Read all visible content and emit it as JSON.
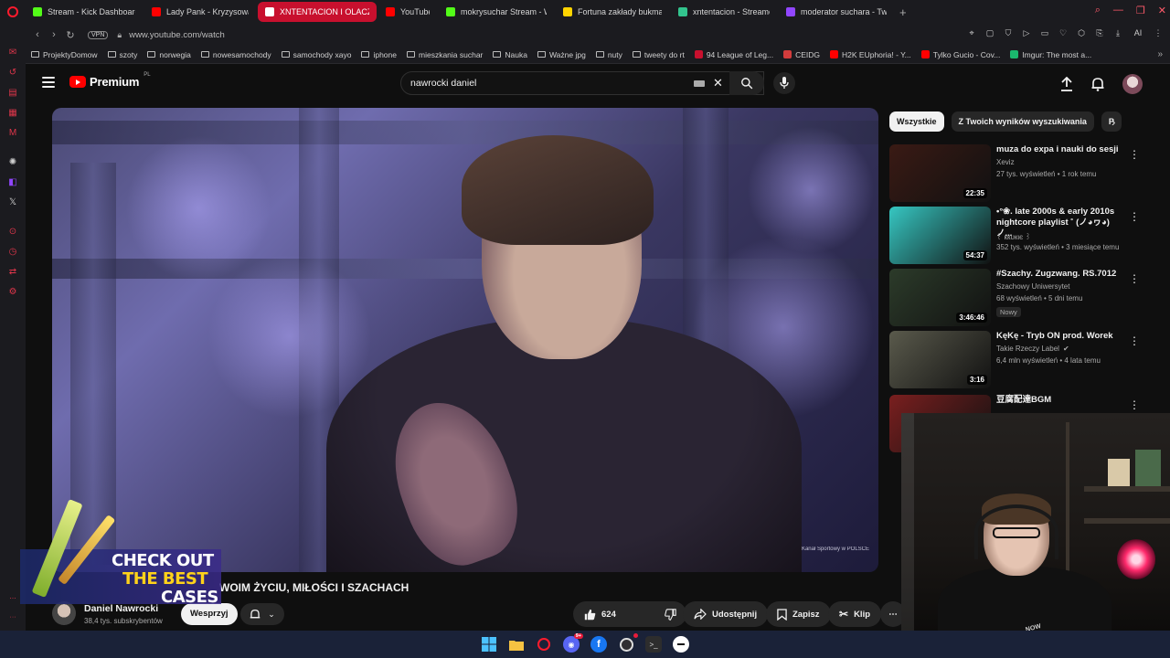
{
  "browser": {
    "tabs": [
      {
        "label": "Stream - Kick Dashboard",
        "icon": "kick-icon",
        "color": "#53fc18",
        "active": false
      },
      {
        "label": "Lady Pank - Kryzysowa N",
        "icon": "youtube-icon",
        "color": "#ff0000",
        "active": false
      },
      {
        "label": "XNTENTACION I OLACZK",
        "icon": "youtube-icon",
        "color": "#ff0000",
        "active": true
      },
      {
        "label": "YouTube",
        "icon": "youtube-icon",
        "color": "#ff0000",
        "active": false
      },
      {
        "label": "mokrysuchar Stream - We",
        "icon": "kick-icon",
        "color": "#53fc18",
        "active": false
      },
      {
        "label": "Fortuna zakłady bukmache",
        "icon": "fortuna-icon",
        "color": "#ffd400",
        "active": false
      },
      {
        "label": "xntentacion - Streamer Ov",
        "icon": "tt-icon",
        "color": "#32c48d",
        "active": false
      },
      {
        "label": "moderator suchara - Twitc",
        "icon": "twitch-icon",
        "color": "#9146ff",
        "active": false
      }
    ],
    "new_tab": "+",
    "url": "www.youtube.com/watch",
    "vpn": "VPN",
    "ai_label": "AI",
    "bookmarks": [
      {
        "label": "ProjektyDomow",
        "type": "folder"
      },
      {
        "label": "szoty",
        "type": "folder"
      },
      {
        "label": "norwegia",
        "type": "folder"
      },
      {
        "label": "nowesamochody",
        "type": "folder"
      },
      {
        "label": "samochody xayo",
        "type": "folder"
      },
      {
        "label": "iphone",
        "type": "folder"
      },
      {
        "label": "mieszkania suchar",
        "type": "folder"
      },
      {
        "label": "Nauka",
        "type": "folder"
      },
      {
        "label": "Ważne jpg",
        "type": "folder"
      },
      {
        "label": "nuty",
        "type": "folder"
      },
      {
        "label": "tweety do rt",
        "type": "folder"
      },
      {
        "label": "94 League of Leg...",
        "type": "site",
        "color": "#c8102e"
      },
      {
        "label": "CEIDG",
        "type": "site",
        "color": "#d23c3c"
      },
      {
        "label": "H2K EUphoria! - Y...",
        "type": "site",
        "color": "#ff0000"
      },
      {
        "label": "Tylko Gucio - Cov...",
        "type": "site",
        "color": "#ff0000"
      },
      {
        "label": "Imgur: The most a...",
        "type": "site",
        "color": "#1bb76e"
      }
    ]
  },
  "youtube": {
    "logo_text": "Premium",
    "logo_region": "PL",
    "search_value": "nawrocki daniel",
    "video": {
      "title": "WOIM ŻYCIU, MIŁOŚCI I SZACHACH",
      "watermark": "Kanał Sportowy w POLSCE",
      "channel_name": "Daniel Nawrocki",
      "subscribers": "38,4 tys. subskrybentów",
      "join_label": "Wesprzyj",
      "likes": "624",
      "share_label": "Udostępnij",
      "save_label": "Zapisz",
      "clip_label": "Klip"
    },
    "chips": [
      "Wszystkie",
      "Z Twoich wyników wyszukiwania",
      "P"
    ],
    "recommendations": [
      {
        "title": "muza do expa i nauki do sesji",
        "channel": "Xeviz",
        "meta": "27 tys. wyświetleń • 1 rok temu",
        "duration": "22:35",
        "thumb": "#3a1a14",
        "music": true
      },
      {
        "title": "•°❀. late 2000s & early 2010s nightcore playlist ˚ (ノ◕ヮ◕)ノ...",
        "channel": "꒰ ккυкιє ꒱",
        "meta": "352 tys. wyświetleń • 3 miesiące temu",
        "duration": "54:37",
        "thumb": "#36c7c2",
        "music": false
      },
      {
        "title": "#Szachy. Zugzwang. RS.7012",
        "channel": "Szachowy Uniwersytet",
        "meta": "68 wyświetleń • 5 dni temu",
        "badge": "Nowy",
        "duration": "3:46:46",
        "thumb": "#2c3b2a",
        "music": false
      },
      {
        "title": "KęKę - Tryb ON prod. Worek",
        "channel": "Takie Rzeczy Label",
        "meta": "6,4 mln wyświetleń • 4 lata temu",
        "duration": "3:16",
        "thumb": "#5a5a4c",
        "music": true,
        "verified": true
      },
      {
        "title": "豆腐配達BGM",
        "channel": "",
        "meta": "",
        "duration": "",
        "thumb": "#7a1f1f",
        "music": false
      }
    ]
  },
  "promo": {
    "line1": "CHECK OUT",
    "line2": "THE BEST",
    "line3": "CASES"
  },
  "webcam": {
    "hoodie_text": "NOW"
  }
}
